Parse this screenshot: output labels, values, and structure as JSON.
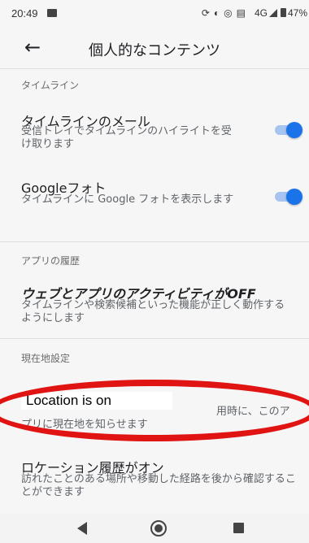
{
  "status_bar": {
    "time": "20:49",
    "network": "4G",
    "battery": "47%"
  },
  "header": {
    "title": "個人的なコンテンツ"
  },
  "timeline_section": {
    "header": "タイムライン",
    "timeline_email": {
      "title": "タイムラインのメール",
      "subtitle": "受信トレイでタイムラインのハイライトを受け取ります",
      "enabled": true
    },
    "google_photos": {
      "title": "Googleフォト",
      "subtitle": "タイムラインに Google フォトを表示します",
      "enabled": true
    }
  },
  "app_history_section": {
    "header": "アプリの履歴",
    "web_app_activity": {
      "title": "ウェブとアプリのアクティビティがOFF",
      "subtitle": "タイムラインや検索候補といった機能が正しく動作するようにします"
    }
  },
  "location_section": {
    "header": "現在地設定",
    "location": {
      "label": "Location is on",
      "subtitle_visible_end": "用時に、このア",
      "subtitle_line2": "プリに現在地を知らせます"
    },
    "location_history": {
      "title": "ロケーション履歴がオン",
      "subtitle": "訪れたことのある場所や移動した経路を後から確認することができます"
    }
  },
  "colors": {
    "toggle_on": "#1a73e8",
    "annotation": "#e11414"
  },
  "icons": {
    "back": "arrow-back-icon",
    "nav_back": "triangle-back-icon",
    "nav_home": "circle-home-icon",
    "nav_recent": "square-recent-icon"
  }
}
